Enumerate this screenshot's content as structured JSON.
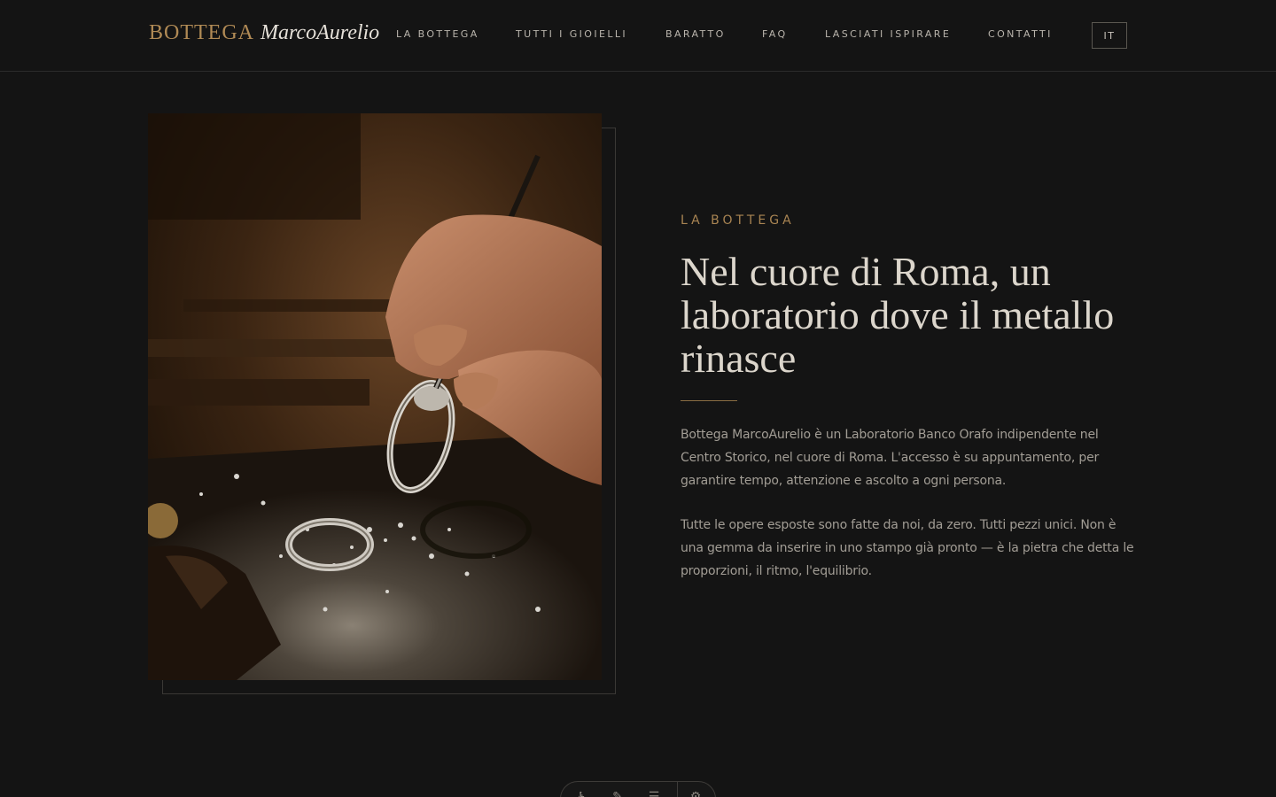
{
  "brand": {
    "word1": "BOTTEGA",
    "word2": "MarcoAurelio"
  },
  "nav": {
    "items": [
      {
        "label": "LA BOTTEGA"
      },
      {
        "label": "TUTTI I GIOIELLI"
      },
      {
        "label": "BARATTO"
      },
      {
        "label": "FAQ"
      },
      {
        "label": "LASCIATI ISPIRARE"
      },
      {
        "label": "CONTATTI"
      }
    ],
    "language": "IT"
  },
  "section": {
    "eyebrow": "LA BOTTEGA",
    "headline": "Nel cuore di Roma, un laboratorio dove il metallo rinasce",
    "paragraph1": "Bottega MarcoAurelio è un Laboratorio Banco Orafo indipendente nel Centro Storico, nel cuore di Roma. L'accesso è su appuntamento, per garantire tempo, attenzione e ascolto a ogni persona.",
    "paragraph2": "Tutte le opere esposte sono fatte da noi, da zero. Tutti pezzi unici. Non è una gemma da inserire in uno stampo già pronto — è la pietra che detta le proporzioni, il ritmo, l'equilibrio."
  },
  "colors": {
    "background": "#141414",
    "accent_gold": "#b08a55",
    "heading": "#dcd6cc",
    "body_text": "#a29d95"
  },
  "toolbar": {
    "icons": [
      "accessibility-icon",
      "brush-icon",
      "menu-lines-icon",
      "settings-icon"
    ]
  }
}
